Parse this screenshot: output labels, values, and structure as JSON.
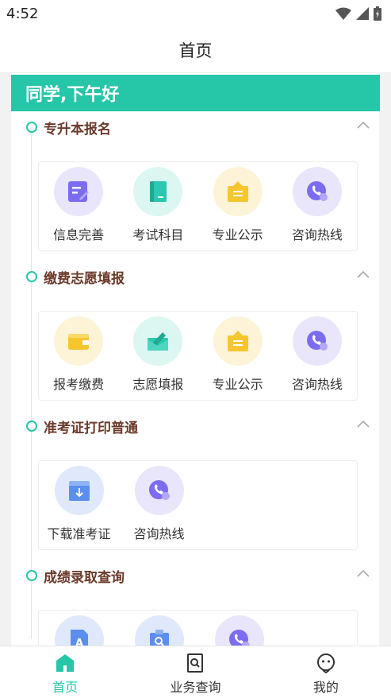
{
  "status_bar": {
    "time": "4:52"
  },
  "header": {
    "title": "首页"
  },
  "greeting": "同学,下午好",
  "sections": [
    {
      "title": "专升本报名",
      "items": [
        {
          "label": "信息完善",
          "icon": "edit-document-icon"
        },
        {
          "label": "考试科目",
          "icon": "book-icon"
        },
        {
          "label": "专业公示",
          "icon": "notice-box-icon"
        },
        {
          "label": "咨询热线",
          "icon": "phone-icon"
        }
      ]
    },
    {
      "title": "缴费志愿填报",
      "items": [
        {
          "label": "报考缴费",
          "icon": "wallet-icon"
        },
        {
          "label": "志愿填报",
          "icon": "envelope-edit-icon"
        },
        {
          "label": "专业公示",
          "icon": "notice-box-icon"
        },
        {
          "label": "咨询热线",
          "icon": "phone-icon"
        }
      ]
    },
    {
      "title": "准考证打印普通",
      "items": [
        {
          "label": "下载准考证",
          "icon": "download-box-icon"
        },
        {
          "label": "咨询热线",
          "icon": "phone-icon"
        }
      ]
    },
    {
      "title": "成绩录取查询",
      "items": [
        {
          "label": "",
          "icon": "score-document-icon"
        },
        {
          "label": "",
          "icon": "search-folder-icon"
        },
        {
          "label": "",
          "icon": "phone-icon"
        }
      ]
    }
  ],
  "bottom_nav": [
    {
      "label": "首页",
      "icon": "home-icon",
      "active": true
    },
    {
      "label": "业务查询",
      "icon": "search-document-icon",
      "active": false
    },
    {
      "label": "我的",
      "icon": "profile-face-icon",
      "active": false
    }
  ],
  "colors": {
    "accent": "#26c6a8",
    "section_title": "#6b3a2a",
    "background": "#f2f2f2"
  }
}
